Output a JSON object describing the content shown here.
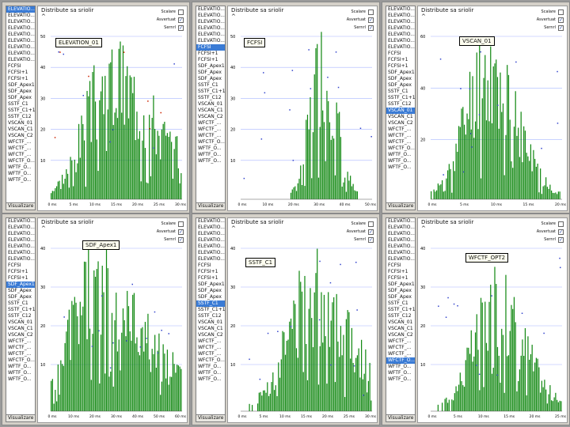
{
  "colors": {
    "bar": "#118811",
    "grid": "#a8b6ff",
    "dot_red": "#cc2200",
    "dot_blue": "#3344cc",
    "selection": "#3a7bd5"
  },
  "common": {
    "plot_title": "Distribute sa sriolir",
    "caret": "^",
    "visualizer_label": "Visualizare",
    "legend": [
      {
        "label": "Scalare",
        "checked": false
      },
      {
        "label": "Asvertuat",
        "checked": true
      },
      {
        "label": "Sernrl",
        "checked": true
      }
    ]
  },
  "panels": [
    {
      "tag": "ELEVATION_01",
      "list": [
        "ELEVATIO...",
        "ELEVATIO...",
        "ELEVATIO...",
        "ELEVATIO...",
        "ELEVATIO...",
        "ELEVATIO...",
        "ELEVATIO...",
        "ELEVATIO...",
        "ELEVATIO...",
        "FCFSI",
        "FCFSI+1",
        "FCFSI+1",
        "SDF_Apex1",
        "SDF_Apex",
        "SDF_Apex",
        "SSTF_C1",
        "SSTF_C1+1",
        "SSTF_C12",
        "VSCAN_01",
        "VSCAN_C1",
        "VSCAN_C2",
        "WFCTF_...",
        "WFCTF_...",
        "WFCTF_...",
        "WFCTF_O...",
        "WFTF_O...",
        "WFTF_O...",
        "WFTF_O..."
      ],
      "selected": 0,
      "y_ticks": [
        "50",
        "40",
        "30",
        "20",
        "10"
      ],
      "x_ticks": [
        "0 ms",
        "5 ms",
        "10 ms",
        "15 ms",
        "20 ms",
        "25 ms",
        "30 ms"
      ],
      "has_red": true
    },
    {
      "tag": "FCFSI",
      "list": [
        "ELEVATIO...",
        "ELEVATIO...",
        "ELEVATIO...",
        "ELEVATIO...",
        "ELEVATIO...",
        "ELEVATIO...",
        "FCFSI",
        "FCFSI+1",
        "FCFSI+1",
        "SDF_Apex1",
        "SDF_Apex",
        "SDF_Apex",
        "SSTF_C1",
        "SSTF_C1+1",
        "SSTF_C12",
        "VSCAN_01",
        "VSCAN_C1",
        "VSCAN_C2",
        "WFCTF_...",
        "WFCTF_...",
        "WFCTF_...",
        "WFCTF_O...",
        "WFTF_O...",
        "WFTF_O...",
        "WFTF_O..."
      ],
      "selected": 6,
      "y_ticks": [
        "50",
        "40",
        "30",
        "20",
        "10"
      ],
      "x_ticks": [
        "0 ms",
        "10 ms",
        "20 ms",
        "30 ms",
        "40 ms",
        "50 ms"
      ],
      "has_red": false
    },
    {
      "tag": "VSCAN_01",
      "list": [
        "ELEVATIO...",
        "ELEVATIO...",
        "ELEVATIO...",
        "ELEVATIO...",
        "ELEVATIO...",
        "ELEVATIO...",
        "ELEVATIO...",
        "FCFSI",
        "FCFSI+1",
        "FCFSI+1",
        "SDF_Apex1",
        "SDF_Apex",
        "SDF_Apex",
        "SSTF_C1",
        "SSTF_C1+1",
        "SSTF_C12",
        "VSCAN_01",
        "VSCAN_C1",
        "VSCAN_C2",
        "WFCTF_...",
        "WFCTF_...",
        "WFCTF_...",
        "WFCTF_O...",
        "WFTF_O...",
        "WFTF_O...",
        "WFTF_O..."
      ],
      "selected": 16,
      "y_ticks": [
        "60",
        "40",
        "20"
      ],
      "x_ticks": [
        "0 ms",
        "5 ms",
        "10 ms",
        "15 ms",
        "20 ms"
      ],
      "has_red": false
    },
    {
      "tag": "SDF_Apex1",
      "list": [
        "ELEVATIO...",
        "ELEVATIO...",
        "ELEVATIO...",
        "ELEVATIO...",
        "ELEVATIO...",
        "ELEVATIO...",
        "ELEVATIO...",
        "FCFSI",
        "FCFSI+1",
        "FCFSI+1",
        "SDF_Apex1",
        "SDF_Apex",
        "SDF_Apex",
        "SSTF_C1",
        "SSTF_C1+1",
        "SSTF_C12",
        "VSCAN_01",
        "VSCAN_C1",
        "VSCAN_C2",
        "WFCTF_...",
        "WFCTF_...",
        "WFCTF_...",
        "WFCTF_O...",
        "WFTF_O...",
        "WFTF_O...",
        "WFTF_O..."
      ],
      "selected": 10,
      "y_ticks": [
        "40",
        "30",
        "20",
        "10"
      ],
      "x_ticks": [
        "0 ms",
        "10 ms",
        "20 ms",
        "30 ms",
        "40 ms",
        "50 ms",
        "60 ms"
      ],
      "has_red": false
    },
    {
      "tag": "SSTF_C1",
      "list": [
        "ELEVATIO...",
        "ELEVATIO...",
        "ELEVATIO...",
        "ELEVATIO...",
        "ELEVATIO...",
        "ELEVATIO...",
        "ELEVATIO...",
        "FCFSI",
        "FCFSI+1",
        "FCFSI+1",
        "SDF_Apex1",
        "SDF_Apex",
        "SDF_Apex",
        "SSTF_C1",
        "SSTF_C1+1",
        "SSTF_C12",
        "VSCAN_01",
        "VSCAN_C1",
        "VSCAN_C2",
        "WFCTF_...",
        "WFCTF_...",
        "WFCTF_...",
        "WFCTF_O...",
        "WFTF_O...",
        "WFTF_O...",
        "WFTF_O..."
      ],
      "selected": 13,
      "y_ticks": [
        "40",
        "30",
        "20",
        "10"
      ],
      "x_ticks": [
        "0 ms",
        "5 ms",
        "10 ms",
        "15 ms",
        "20 ms",
        "25 ms",
        "30 ms"
      ],
      "has_red": false
    },
    {
      "tag": "WFCTF_OPT2",
      "list": [
        "ELEVATIO...",
        "ELEVATIO...",
        "ELEVATIO...",
        "ELEVATIO...",
        "ELEVATIO...",
        "ELEVATIO...",
        "ELEVATIO...",
        "FCFSI",
        "FCFSI+1",
        "FCFSI+1",
        "SDF_Apex1",
        "SDF_Apex",
        "SDF_Apex",
        "SSTF_C1",
        "SSTF_C1+1",
        "SSTF_C12",
        "VSCAN_01",
        "VSCAN_C1",
        "VSCAN_C2",
        "WFCTF_...",
        "WFCTF_...",
        "WFCTF_...",
        "WFCTF_O...",
        "WFTF_O...",
        "WFTF_O...",
        "WFTF_O..."
      ],
      "selected": 22,
      "y_ticks": [
        "40",
        "30",
        "20",
        "10"
      ],
      "x_ticks": [
        "0 ms",
        "5 ms",
        "10 ms",
        "15 ms",
        "20 ms",
        "25 ms"
      ],
      "has_red": false
    }
  ]
}
